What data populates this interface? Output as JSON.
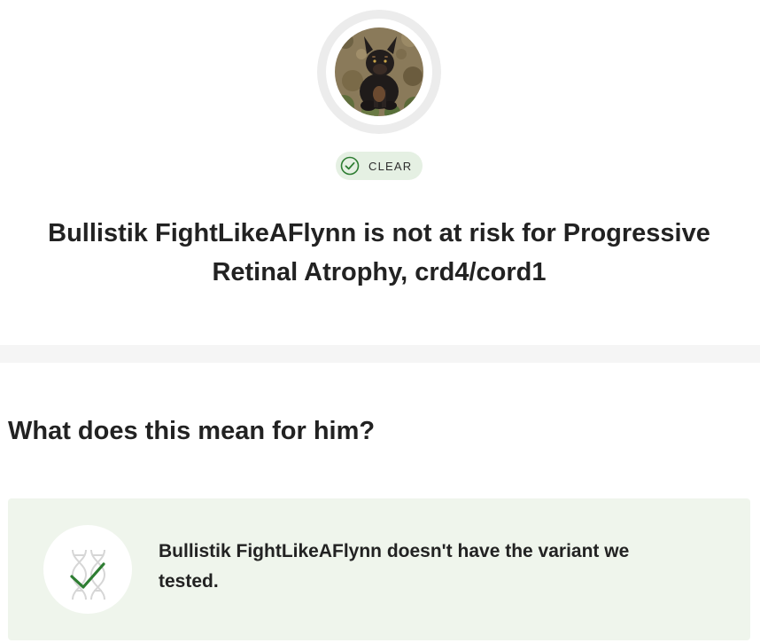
{
  "result": {
    "badge_label": "CLEAR",
    "headline": "Bullistik FightLikeAFlynn is not at risk for Progressive Retinal Atrophy, crd4/cord1"
  },
  "section": {
    "heading": "What does this mean for him?",
    "card_text": "Bullistik FightLikeAFlynn doesn't have the variant we tested."
  },
  "icons": {
    "badge": "check-circle-icon",
    "card": "dna-check-icon"
  },
  "colors": {
    "accent_green": "#2e7d32",
    "badge_bg": "#e5f0e3",
    "card_bg": "#eff5ec"
  }
}
